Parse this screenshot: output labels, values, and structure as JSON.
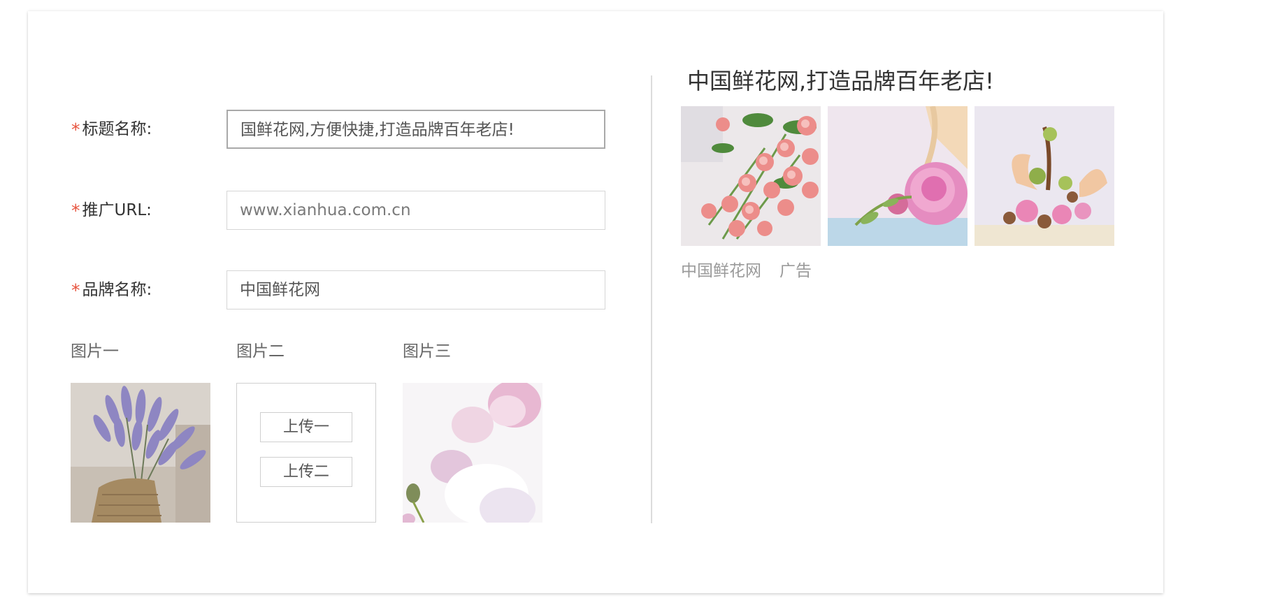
{
  "form": {
    "fields": [
      {
        "label": "标题名称:",
        "value": "国鲜花网,方便快捷,打造品牌百年老店!",
        "required_mark": "*"
      },
      {
        "label": "推广URL:",
        "placeholder": "www.xianhua.com.cn",
        "required_mark": "*"
      },
      {
        "label": "品牌名称:",
        "value": "中国鲜花网",
        "required_mark": "*"
      }
    ],
    "images": {
      "label_1": "图片一",
      "label_2": "图片二",
      "label_3": "图片三",
      "upload_1": "上传一",
      "upload_2": "上传二"
    }
  },
  "preview": {
    "title": "中国鲜花网,打造品牌百年老店!",
    "brand": "中国鲜花网",
    "ad_tag": "广告"
  },
  "colors": {
    "required_star": "#e7543f",
    "border": "#d6d6d6",
    "divider": "#dcdcdc"
  }
}
